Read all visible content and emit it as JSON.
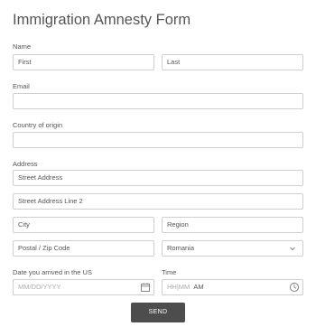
{
  "form": {
    "title": "Immigration Amnesty Form",
    "name": {
      "label": "Name",
      "first_placeholder": "First",
      "last_placeholder": "Last"
    },
    "email": {
      "label": "Email",
      "value": ""
    },
    "country": {
      "label": "Country of origin",
      "value": ""
    },
    "address": {
      "label": "Address",
      "street_placeholder": "Street Address",
      "street2_placeholder": "Street Address Line 2",
      "city_placeholder": "City",
      "region_placeholder": "Region",
      "postal_placeholder": "Postal / Zip Code",
      "country_selected": "Romania"
    },
    "date": {
      "label": "Date you arrived in the US",
      "placeholder": "MM/DD/YYYY"
    },
    "time": {
      "label": "Time",
      "placeholder": "HH|MM",
      "ampm": "AM"
    },
    "send_label": "SEND"
  },
  "icons": {
    "calendar": "calendar-icon",
    "clock": "clock-icon",
    "dropdown": "chevron-down-icon"
  }
}
